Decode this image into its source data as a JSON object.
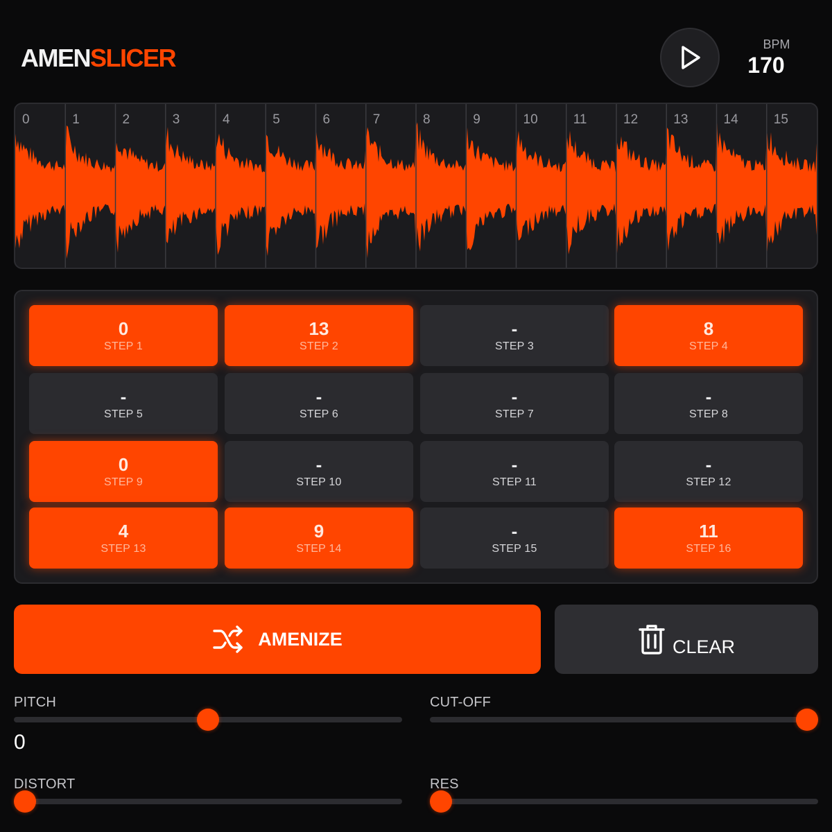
{
  "header": {
    "logo_primary": "AMEN",
    "logo_accent": "SLICER",
    "bpm_label": "BPM",
    "bpm_value": "170"
  },
  "waveform": {
    "slice_labels": [
      "0",
      "1",
      "2",
      "3",
      "4",
      "5",
      "6",
      "7",
      "8",
      "9",
      "10",
      "11",
      "12",
      "13",
      "14",
      "15"
    ],
    "color": "#ff4500"
  },
  "steps": [
    {
      "value": "0",
      "label": "STEP 1",
      "active": true
    },
    {
      "value": "13",
      "label": "STEP 2",
      "active": true
    },
    {
      "value": "-",
      "label": "STEP 3",
      "active": false
    },
    {
      "value": "8",
      "label": "STEP 4",
      "active": true
    },
    {
      "value": "-",
      "label": "STEP 5",
      "active": false
    },
    {
      "value": "-",
      "label": "STEP 6",
      "active": false
    },
    {
      "value": "-",
      "label": "STEP 7",
      "active": false
    },
    {
      "value": "-",
      "label": "STEP 8",
      "active": false
    },
    {
      "value": "0",
      "label": "STEP 9",
      "active": true
    },
    {
      "value": "-",
      "label": "STEP 10",
      "active": false
    },
    {
      "value": "-",
      "label": "STEP 11",
      "active": false
    },
    {
      "value": "-",
      "label": "STEP 12",
      "active": false
    },
    {
      "value": "4",
      "label": "STEP 13",
      "active": true
    },
    {
      "value": "9",
      "label": "STEP 14",
      "active": true
    },
    {
      "value": "-",
      "label": "STEP 15",
      "active": false
    },
    {
      "value": "11",
      "label": "STEP 16",
      "active": true
    }
  ],
  "actions": {
    "amenize_label": "AMENIZE",
    "amenize_icon": "shuffle-icon",
    "clear_label": "CLEAR",
    "clear_icon": "trash-icon"
  },
  "controls": {
    "pitch": {
      "label": "PITCH",
      "value_text": "0",
      "level": 0.5
    },
    "cutoff": {
      "label": "CUT-OFF",
      "level": 1.0
    },
    "distort": {
      "label": "DISTORT",
      "level": 0.0
    },
    "res": {
      "label": "RES",
      "level": 0.0
    }
  },
  "colors": {
    "accent": "#ff4500",
    "background": "#0a0a0b",
    "panel": "#1b1b1e",
    "step_inactive": "#2b2b2f"
  }
}
